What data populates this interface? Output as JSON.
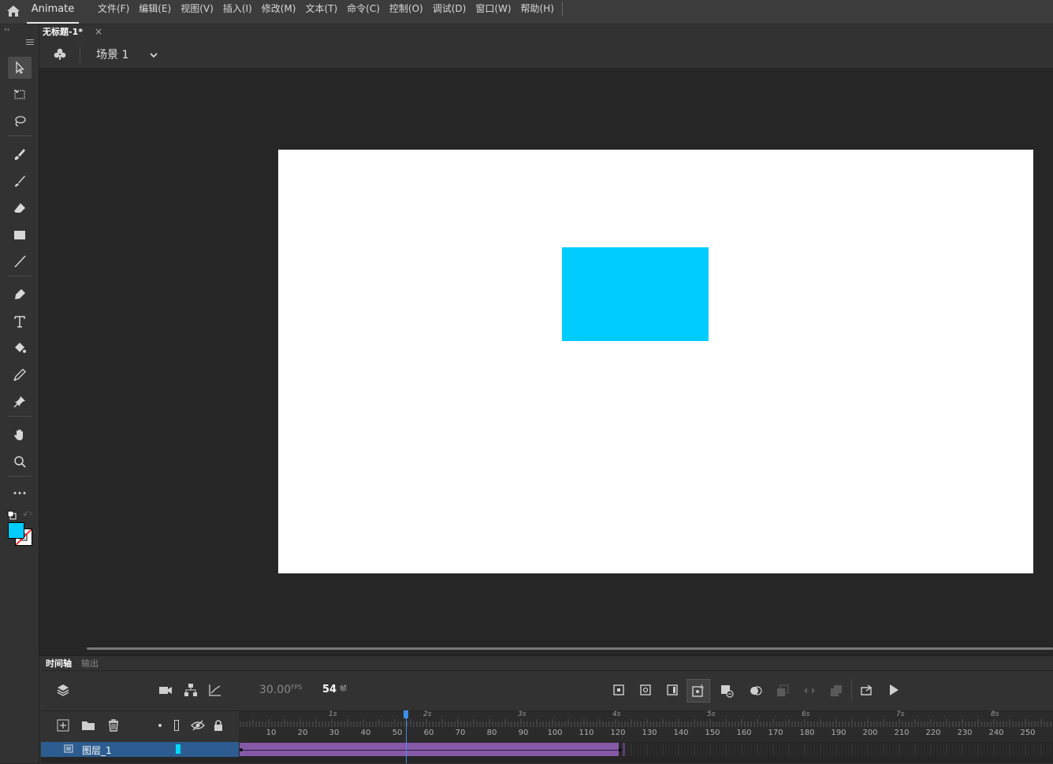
{
  "app": {
    "name": "Animate"
  },
  "menu": [
    "文件(F)",
    "编辑(E)",
    "视图(V)",
    "插入(I)",
    "修改(M)",
    "文本(T)",
    "命令(C)",
    "控制(O)",
    "调试(D)",
    "窗口(W)",
    "帮助(H)"
  ],
  "document": {
    "tab_title": "无标题-1*",
    "close_glyph": "×"
  },
  "scene": {
    "label": "场景 1"
  },
  "stage": {
    "background": "#ffffff",
    "shape_color": "#00ccff"
  },
  "colors": {
    "fill": "#00ccff",
    "stroke": "#000000",
    "layer_highlight": "#2d5d90",
    "tween": "#8659a8",
    "playhead": "#3d8ee8"
  },
  "timeline": {
    "tabs": [
      "时间轴",
      "输出"
    ],
    "fps_value": "30.00",
    "fps_unit": "FPS",
    "current_frame": "54",
    "frame_unit": "帧",
    "seconds": [
      "1s",
      "2s",
      "3s",
      "4s",
      "5s",
      "6s",
      "7s",
      "8s"
    ],
    "frame_ticks": [
      "10",
      "20",
      "30",
      "40",
      "50",
      "60",
      "70",
      "80",
      "90",
      "100",
      "110",
      "120",
      "130",
      "140",
      "150",
      "160",
      "170",
      "180",
      "190",
      "200",
      "210",
      "220",
      "230",
      "240",
      "250"
    ],
    "layer": {
      "name": "图层_1",
      "color": "#00d8ff"
    },
    "tween_start_frame": 1,
    "tween_end_frame": 120
  },
  "icons": {
    "tools": [
      "selection-tool-icon",
      "free-transform-tool-icon",
      "lasso-tool-icon",
      "paint-brush-tool-icon",
      "brush-tool-icon",
      "eraser-tool-icon",
      "rectangle-tool-icon",
      "line-tool-icon",
      "pen-tool-icon",
      "text-tool-icon",
      "paint-bucket-tool-icon",
      "eyedropper-tool-icon",
      "pin-tool-icon",
      "hand-tool-icon",
      "zoom-tool-icon",
      "more-tools-icon"
    ]
  }
}
